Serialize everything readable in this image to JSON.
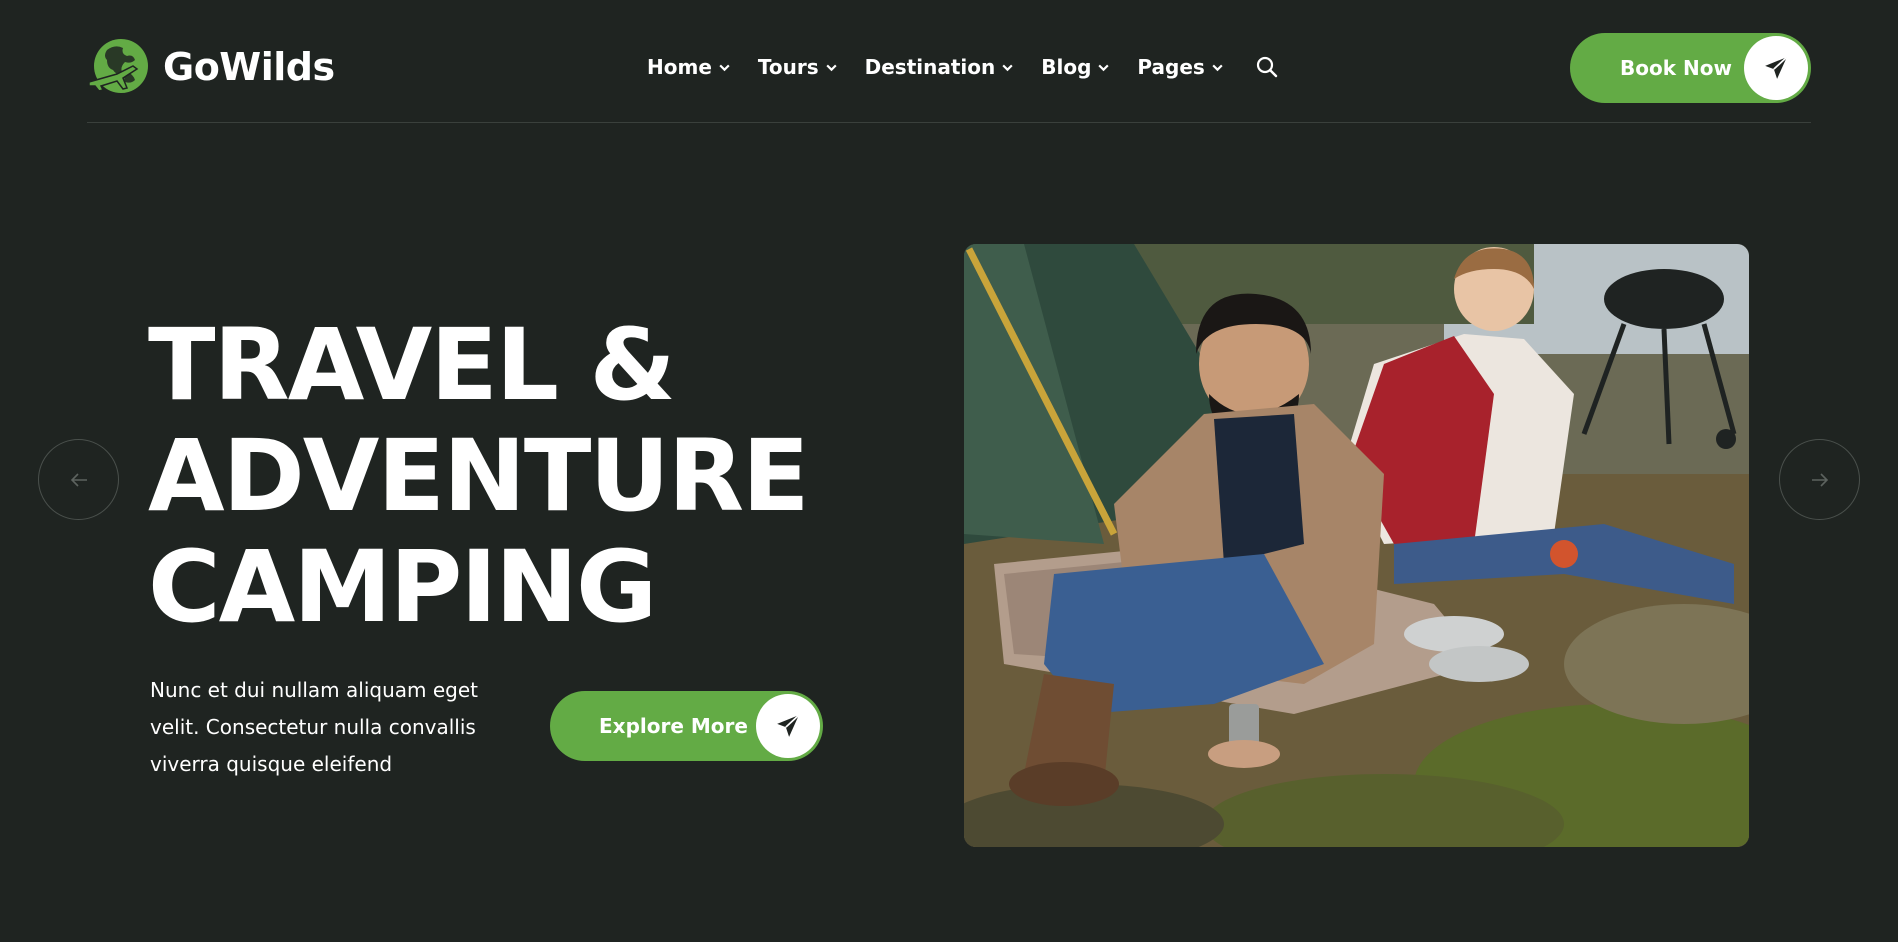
{
  "brand": {
    "name": "GoWilds",
    "accent_color": "#63ab45",
    "background_color": "#1f2421"
  },
  "nav": {
    "items": [
      {
        "label": "Home",
        "icon": "chevron-down-icon"
      },
      {
        "label": "Tours",
        "icon": "chevron-down-icon"
      },
      {
        "label": "Destination",
        "icon": "chevron-down-icon"
      },
      {
        "label": "Blog",
        "icon": "chevron-down-icon"
      },
      {
        "label": "Pages",
        "icon": "chevron-down-icon"
      }
    ],
    "search_icon": "search-icon"
  },
  "header": {
    "book_label": "Book Now",
    "book_icon": "paper-plane-icon"
  },
  "hero": {
    "title_lines": [
      "TRAVEL &",
      "ADVENTURE",
      "CAMPING"
    ],
    "description": "Nunc et dui nullam aliquam eget velit. Consectetur nulla convallis viverra quisque eleifend",
    "cta_label": "Explore More",
    "cta_icon": "paper-plane-icon",
    "image_subject": "couple-camping-photo"
  },
  "slider": {
    "prev_icon": "arrow-left-icon",
    "next_icon": "arrow-right-icon"
  }
}
